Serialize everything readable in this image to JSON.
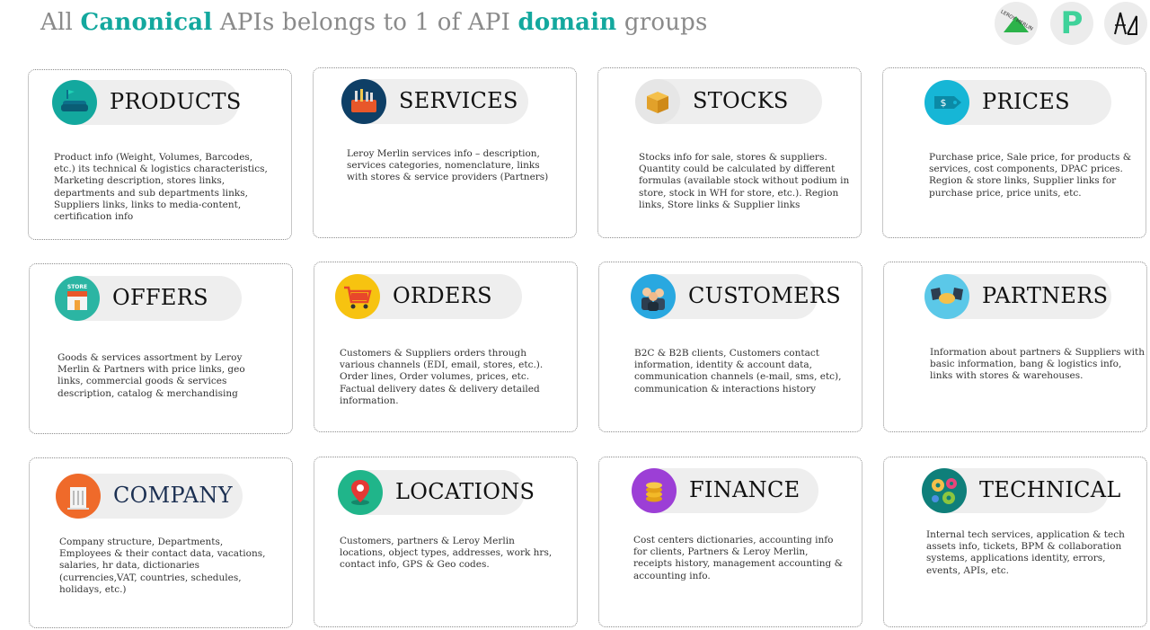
{
  "title": {
    "part1": "All",
    "highlight1": "Canonical",
    "part2": "APIs belongs to 1 of API",
    "highlight2": "domain",
    "part3": "groups"
  },
  "colors": {
    "accent": "#13a89e",
    "muted": "#8a8a8a"
  },
  "logos": [
    {
      "name": "leroy-merlin-logo",
      "text": "LEROY MERLIN"
    },
    {
      "name": "p-logo",
      "text": "P"
    },
    {
      "name": "compass-logo",
      "text": ""
    }
  ],
  "domains": [
    {
      "key": "products",
      "label": "PRODUCTS",
      "icon": "sofa-icon",
      "description": "Product info (Weight, Volumes, Barcodes, etc.) its technical & logistics characteristics, Marketing description, stores links, departments and sub departments links, Suppliers links, links to media-content, certification info"
    },
    {
      "key": "services",
      "label": "SERVICES",
      "icon": "toolbox-icon",
      "description": "Leroy Merlin services info – description, services categories, nomenclature, links with stores & service providers (Partners)"
    },
    {
      "key": "stocks",
      "label": "STOCKS",
      "icon": "box-icon",
      "description": "Stocks info for sale, stores & suppliers. Quantity could be calculated by different formulas (available stock without podium in store, stock in WH for store, etc.). Region links, Store links & Supplier links"
    },
    {
      "key": "prices",
      "label": "PRICES",
      "icon": "price-tag-icon",
      "description": "Purchase price, Sale price, for products & services, cost components, DPAC prices. Region & store links, Supplier links for purchase price, price units, etc."
    },
    {
      "key": "offers",
      "label": "OFFERS",
      "icon": "store-icon",
      "icon_text": "STORE",
      "description": "Goods & services assortment by Leroy Merlin & Partners with price links, geo links, commercial goods & services description, catalog & merchandising"
    },
    {
      "key": "orders",
      "label": "ORDERS",
      "icon": "cart-icon",
      "description": "Customers & Suppliers orders through various channels (EDI, email, stores, etc.). Order lines, Order volumes, prices, etc. Factual delivery dates & delivery detailed information."
    },
    {
      "key": "customers",
      "label": "CUSTOMERS",
      "icon": "people-icon",
      "description": "B2C & B2B clients, Customers contact information, identity & account data, communication channels (e-mail, sms, etc), communication & interactions history"
    },
    {
      "key": "partners",
      "label": "PARTNERS",
      "icon": "handshake-icon",
      "description": "Information about partners & Suppliers with basic information, bang & logistics info, links with stores & warehouses."
    },
    {
      "key": "company",
      "label": "COMPANY",
      "icon": "building-icon",
      "description": "Company structure, Departments, Employees & their contact data, vacations, salaries, hr data, dictionaries (currencies,VAT, countries, schedules, holidays, etc.)"
    },
    {
      "key": "locations",
      "label": "LOCATIONS",
      "icon": "map-pin-icon",
      "description": "Customers, partners & Leroy Merlin locations, object types, addresses, work hrs, contact info, GPS & Geo codes."
    },
    {
      "key": "finance",
      "label": "FINANCE",
      "icon": "coins-icon",
      "description": "Cost centers dictionaries, accounting info for clients, Partners & Leroy Merlin, receipts history, management accounting & accounting info."
    },
    {
      "key": "technical",
      "label": "TECHNICAL",
      "icon": "gears-icon",
      "description": "Internal tech services, application & tech assets info, tickets, BPM & collaboration systems, applications identity, errors, events, APIs, etc."
    }
  ]
}
